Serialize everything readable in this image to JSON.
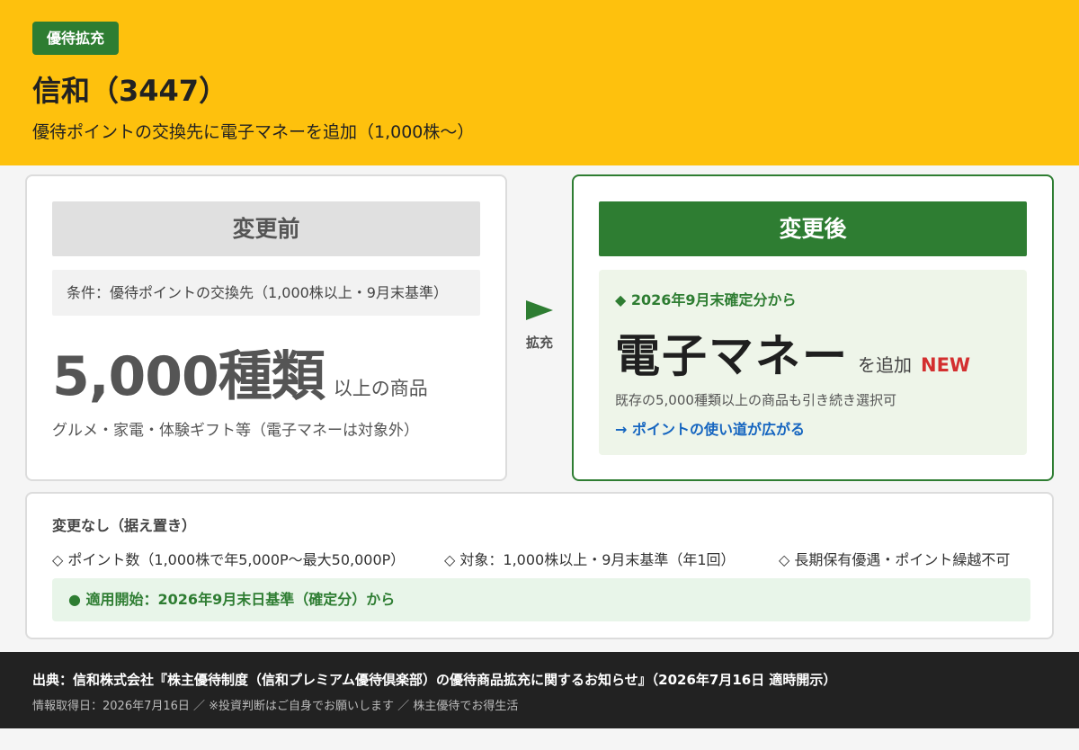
{
  "header": {
    "badge": "優待拡充",
    "title": "信和（3447）",
    "subtitle": "優待ポイントの交換先に電子マネーを追加（1,000株〜）"
  },
  "before": {
    "heading": "変更前",
    "condition": "条件：優待ポイントの交換先（1,000株以上・9月末基準）",
    "big_value": "5,000種類",
    "big_suffix": "以上の商品",
    "note": "グルメ・家電・体験ギフト等（電子マネーは対象外）"
  },
  "transition": {
    "label": "拡充"
  },
  "after": {
    "heading": "変更後",
    "from_date": "◆ 2026年9月末確定分から",
    "main": "電子マネー",
    "add_text": "を追加",
    "new_badge": "NEW",
    "existing_note": "既存の5,000種類以上の商品も引き続き選択可",
    "usage_link": "→ ポイントの使い道が広がる"
  },
  "unchanged": {
    "title": "変更なし（据え置き）",
    "items": [
      "◇ ポイント数（1,000株で年5,000P〜最大50,000P）",
      "◇ 対象：1,000株以上・9月末基準（年1回）",
      "◇ 長期保有優遇・ポイント繰越不可"
    ],
    "start": "● 適用開始：2026年9月末日基準（確定分）から"
  },
  "footer": {
    "source": "出典：信和株式会社『株主優待制度（信和プレミアム優待倶楽部）の優待商品拡充に関するお知らせ』（2026年7月16日 適時開示）",
    "info": "情報取得日：2026年7月16日 ／ ※投資判断はご自身でお願いします ／ 株主優待でお得生活"
  },
  "colors": {
    "header_bg": "#fec10d",
    "accent_green": "#2e7d32",
    "new_red": "#d32f2f",
    "link_blue": "#1565c0",
    "footer_bg": "#222222"
  },
  "icons": {
    "transition_arrow": "triangle-right-icon"
  }
}
